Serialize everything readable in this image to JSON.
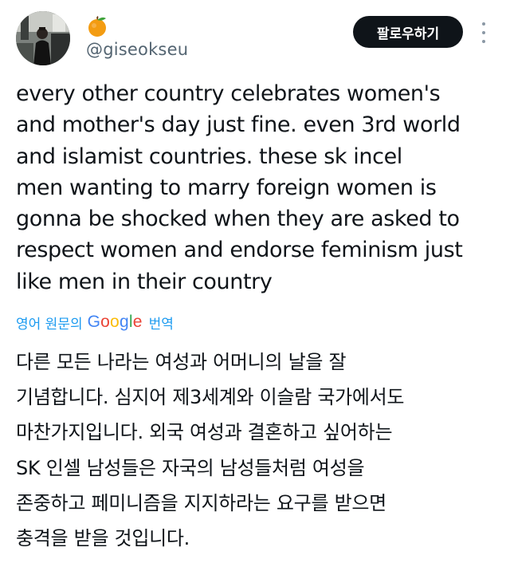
{
  "user": {
    "handle": "@giseokseu",
    "badge_emoji": "tangerine-emoji",
    "avatar": "profile-photo"
  },
  "actions": {
    "follow_label": "팔로우하기",
    "more_icon": "more-vertical-icon"
  },
  "tweet": {
    "lines": [
      "every other country celebrates women's",
      "and mother's day just fine. even 3rd world",
      "and islamist countries. these sk incel",
      "men wanting to marry foreign women is",
      "gonna be shocked when they are asked to",
      "respect women and endorse feminism just",
      "like men in their country"
    ]
  },
  "translation": {
    "prefix": "영어 원문의",
    "provider": "Google",
    "suffix": "번역",
    "lines": [
      "다른 모든 나라는 여성과 어머니의 날을 잘",
      "기념합니다. 심지어 제3세계와 이슬람 국가에서도",
      "마찬가지입니다. 외국 여성과 결혼하고 싶어하는",
      "SK 인셀 남성들은 자국의 남성들처럼 여성을",
      "존중하고 페미니즘을 지지하라는 요구를 받으면",
      "충격을 받을 것입니다."
    ]
  },
  "colors": {
    "link": "#1d9bf0",
    "text": "#0f1419",
    "secondary": "#536471",
    "button_bg": "#0f1419"
  }
}
